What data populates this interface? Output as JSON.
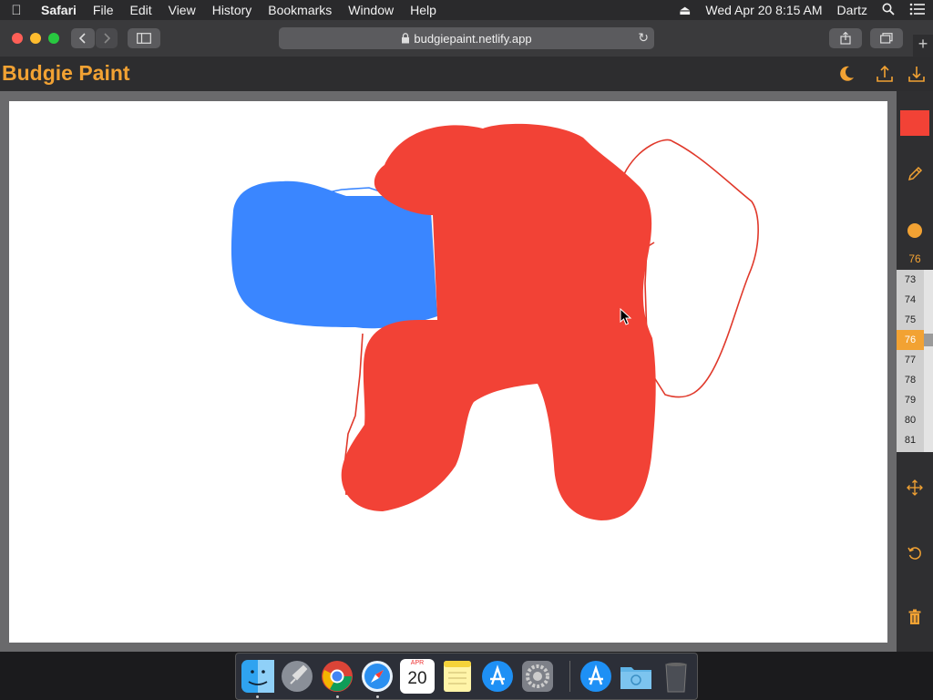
{
  "menubar": {
    "app": "Safari",
    "items": [
      "File",
      "Edit",
      "View",
      "History",
      "Bookmarks",
      "Window",
      "Help"
    ],
    "clock": "Wed Apr 20  8:15 AM",
    "user": "Dartz"
  },
  "browser": {
    "url": "budgiepaint.netlify.app"
  },
  "app": {
    "title": "Budgie Paint"
  },
  "tools": {
    "current_color": "#f24236",
    "brush_size": "76",
    "size_options": [
      "73",
      "74",
      "75",
      "76",
      "77",
      "78",
      "79",
      "80",
      "81"
    ],
    "selected_size": "76",
    "accent": "#f2a233"
  },
  "calendar": {
    "month": "APR",
    "day": "20"
  },
  "colors": {
    "paint_red": "#f24236",
    "paint_blue": "#3a86ff",
    "outline_red": "#e0392b"
  }
}
